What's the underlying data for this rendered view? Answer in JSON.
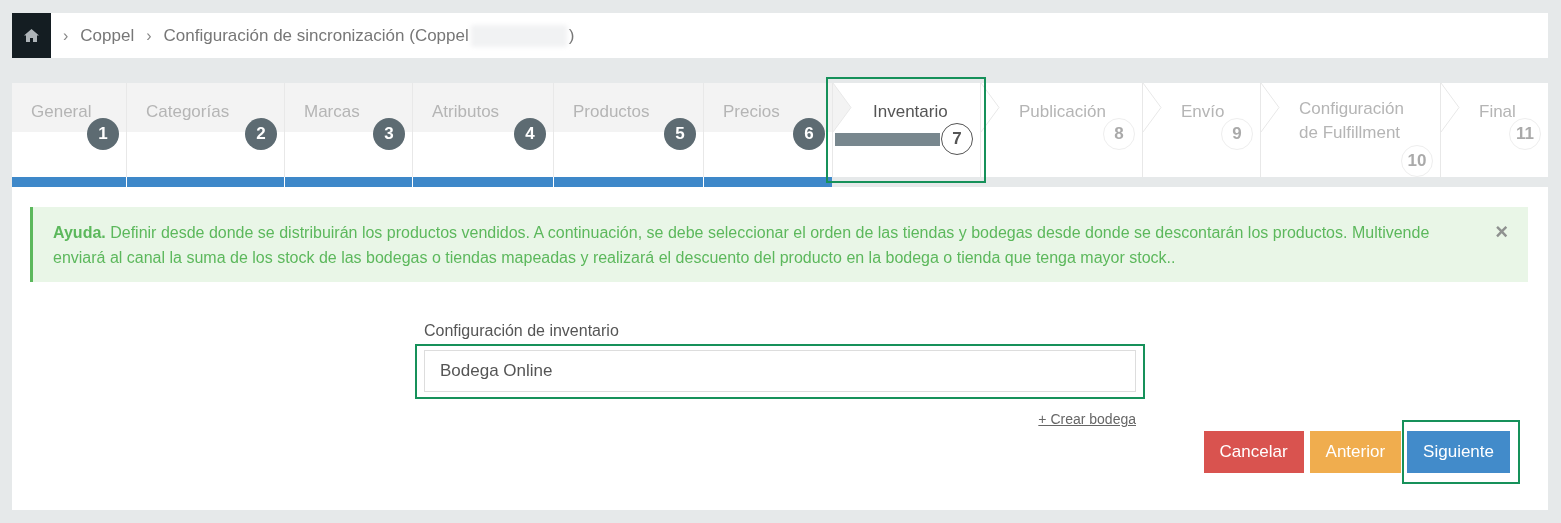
{
  "breadcrumb": {
    "separator": "›",
    "items": [
      "Coppel",
      "Configuración de sincronización (Coppel"
    ],
    "redacted": true,
    "tail": ")"
  },
  "steps": [
    {
      "label": "General",
      "number": "1",
      "completed": true,
      "current": false,
      "highlighted": false
    },
    {
      "label": "Categorías",
      "number": "2",
      "completed": true,
      "current": false,
      "highlighted": false
    },
    {
      "label": "Marcas",
      "number": "3",
      "completed": true,
      "current": false,
      "highlighted": false
    },
    {
      "label": "Atributos",
      "number": "4",
      "completed": true,
      "current": false,
      "highlighted": false
    },
    {
      "label": "Productos",
      "number": "5",
      "completed": true,
      "current": false,
      "highlighted": false
    },
    {
      "label": "Precios",
      "number": "6",
      "completed": true,
      "current": false,
      "highlighted": false
    },
    {
      "label": "Inventario",
      "number": "7",
      "completed": false,
      "current": true,
      "highlighted": true
    },
    {
      "label": "Publicación",
      "number": "8",
      "completed": false,
      "current": false,
      "highlighted": false
    },
    {
      "label": "Envío",
      "number": "9",
      "completed": false,
      "current": false,
      "highlighted": false
    },
    {
      "label": "Configuración de Fulfillment",
      "number": "10",
      "completed": false,
      "current": false,
      "highlighted": false
    },
    {
      "label": "Final",
      "number": "11",
      "completed": false,
      "current": false,
      "highlighted": false
    }
  ],
  "help": {
    "text": "**Ayuda.** Definir desde donde se distribuirán los productos vendidos. A continuación, se debe seleccionar el orden de las tiendas y bodegas desde donde se descontarán los productos. Multivende enviará al canal la suma de los stock de las bodegas o tiendas mapeadas y realizará el descuento del producto en la bodega o tienda que tenga mayor stock..",
    "close": "×"
  },
  "form": {
    "label": "Configuración de inventario",
    "value": "Bodega Online",
    "highlighted": true,
    "link": "+ Crear bodega"
  },
  "buttons": [
    {
      "label": "Cancelar",
      "kind": "danger",
      "highlighted": false
    },
    {
      "label": "Anterior",
      "kind": "warning",
      "highlighted": false
    },
    {
      "label": "Siguiente",
      "kind": "primary",
      "highlighted": true
    }
  ]
}
